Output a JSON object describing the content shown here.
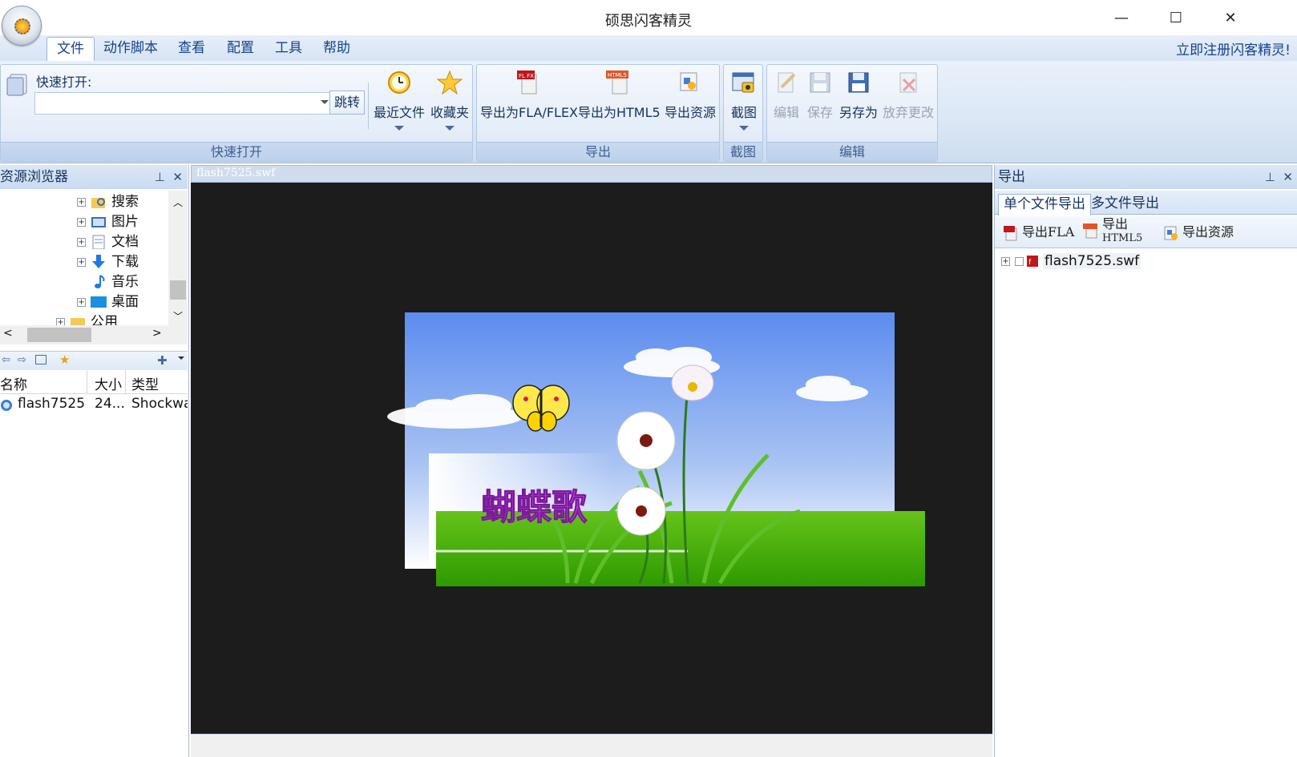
{
  "window": {
    "title": "硕思闪客精灵",
    "minimize": "—",
    "maximize": "☐",
    "close": "✕"
  },
  "menu": {
    "items": [
      "文件",
      "动作脚本",
      "查看",
      "配置",
      "工具",
      "帮助"
    ],
    "register": "立即注册闪客精灵!"
  },
  "ribbon": {
    "quick_open": {
      "label": "快速打开:",
      "input_value": "",
      "jump": "跳转",
      "recent": "最近文件",
      "favorites": "收藏夹",
      "group_label": "快速打开"
    },
    "export": {
      "fla": "导出为FLA/FLEX",
      "html5": "导出为HTML5",
      "resources": "导出资源",
      "group_label": "导出",
      "fla_badge": "FL FX",
      "html5_badge": "HTML5"
    },
    "capture": {
      "button": "截图",
      "group_label": "截图"
    },
    "edit": {
      "edit": "编辑",
      "save": "保存",
      "save_as": "另存为",
      "discard": "放弃更改",
      "group_label": "编辑"
    }
  },
  "resource_browser": {
    "title": "资源浏览器",
    "tree": [
      "搜索",
      "图片",
      "文档",
      "下载",
      "音乐",
      "桌面",
      "公用"
    ],
    "columns": {
      "name": "名称",
      "size": "大小",
      "type": "类型"
    },
    "files": [
      {
        "name": "flash7525",
        "size": "24...",
        "type": "Shockwa"
      }
    ]
  },
  "document": {
    "tab": "flash7525.swf",
    "stage_text": "蝴蝶歌"
  },
  "export_panel": {
    "title": "导出",
    "tabs": [
      "单个文件导出",
      "多文件导出"
    ],
    "toolbar": {
      "fla": "导出FLA",
      "html5_top": "导出",
      "html5_bottom": "HTML5",
      "resources": "导出资源"
    },
    "tree_item": "flash7525.swf"
  },
  "colors": {
    "ribbon_text": "#15325f",
    "stage": "#1c1c1c",
    "accent": "#15428b",
    "stage_title": "#e040fb"
  }
}
